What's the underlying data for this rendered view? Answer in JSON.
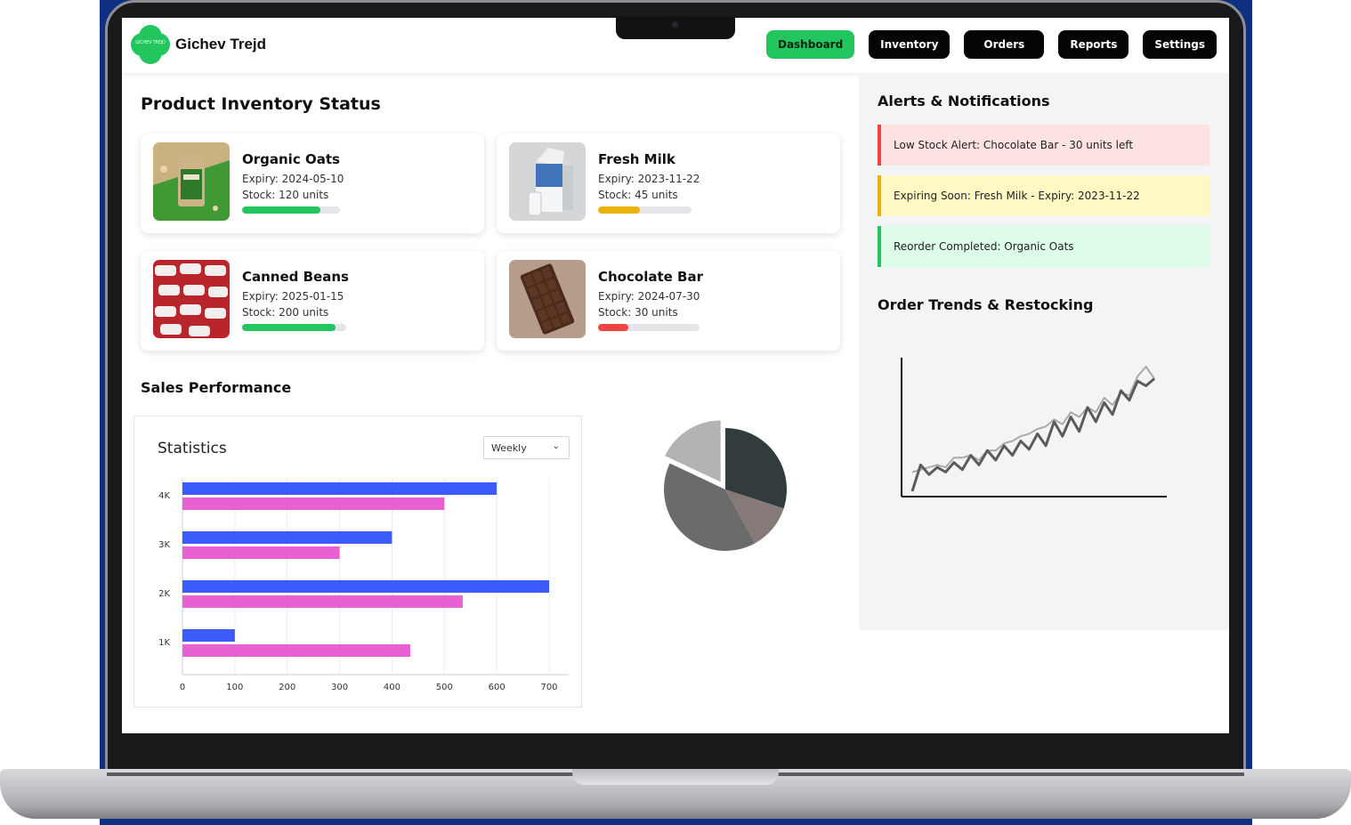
{
  "brand": {
    "name": "Gichev Trejd",
    "badge_text": "GICHEV TREJD"
  },
  "nav": [
    {
      "label": "Dashboard",
      "active": true
    },
    {
      "label": "Inventory"
    },
    {
      "label": "Orders"
    },
    {
      "label": "Reports"
    },
    {
      "label": "Settings"
    }
  ],
  "inventory": {
    "title": "Product Inventory Status",
    "products": [
      {
        "name": "Organic Oats",
        "expiry": "Expiry: 2024-05-10",
        "stock": "Stock: 120 units",
        "level": 0.8,
        "color": "#22c55e",
        "image": "oats-pack-image"
      },
      {
        "name": "Fresh Milk",
        "expiry": "Expiry: 2023-11-22",
        "stock": "Stock: 45 units",
        "level": 0.45,
        "color": "#eab308",
        "image": "milk-carton-image"
      },
      {
        "name": "Canned Beans",
        "expiry": "Expiry: 2025-01-15",
        "stock": "Stock: 200 units",
        "level": 0.9,
        "color": "#22c55e",
        "image": "canned-beans-image"
      },
      {
        "name": "Chocolate Bar",
        "expiry": "Expiry: 2024-07-30",
        "stock": "Stock: 30 units",
        "level": 0.3,
        "color": "#ef4444",
        "image": "chocolate-bar-image"
      }
    ]
  },
  "sales": {
    "title": "Sales Performance",
    "stats_title": "Statistics",
    "period": "Weekly"
  },
  "alerts": {
    "title": "Alerts & Notifications",
    "items": [
      {
        "text": "Low Stock Alert: Chocolate Bar - 30 units left",
        "bg": "#fde2e2",
        "border": "#ef4444"
      },
      {
        "text": "Expiring Soon: Fresh Milk - Expiry: 2023-11-22",
        "bg": "#fef9c3",
        "border": "#eab308"
      },
      {
        "text": "Reorder Completed: Organic Oats",
        "bg": "#dcfce7",
        "border": "#22c55e"
      }
    ]
  },
  "trends": {
    "title": "Order Trends & Restocking"
  },
  "chart_data": [
    {
      "type": "bar",
      "orientation": "horizontal",
      "categories": [
        "4K",
        "3K",
        "2K",
        "1K"
      ],
      "series": [
        {
          "values": [
            600,
            400,
            700,
            100
          ],
          "color": "#3b5bfd"
        },
        {
          "values": [
            500,
            300,
            535,
            435
          ],
          "color": "#e960d2"
        }
      ],
      "xticks": [
        "0",
        "100",
        "200",
        "300",
        "400",
        "500",
        "600",
        "700"
      ],
      "xlim": [
        0,
        700
      ],
      "grid": true
    },
    {
      "type": "pie",
      "slices": [
        {
          "value": 30,
          "color": "#323c3c",
          "exploded": false
        },
        {
          "value": 12,
          "color": "#857a78",
          "exploded": false
        },
        {
          "value": 40,
          "color": "#6b6b6b",
          "exploded": false
        },
        {
          "value": 18,
          "color": "#b3b3b3",
          "exploded": true
        }
      ]
    },
    {
      "type": "line",
      "grid": false,
      "series": [
        {
          "color": "#5b5b5b",
          "values": [
            0,
            22,
            14,
            20,
            16,
            24,
            18,
            30,
            22,
            34,
            26,
            38,
            30,
            42,
            35,
            48,
            38,
            58,
            46,
            62,
            50,
            70,
            58,
            74,
            64,
            84,
            76,
            92,
            88,
            94
          ]
        },
        {
          "color": "#aaaaaa",
          "values": [
            16,
            18,
            20,
            22,
            20,
            28,
            28,
            30,
            26,
            34,
            34,
            40,
            42,
            46,
            48,
            52,
            54,
            60,
            56,
            66,
            62,
            70,
            66,
            78,
            72,
            82,
            80,
            96,
            104,
            94
          ]
        }
      ]
    }
  ]
}
